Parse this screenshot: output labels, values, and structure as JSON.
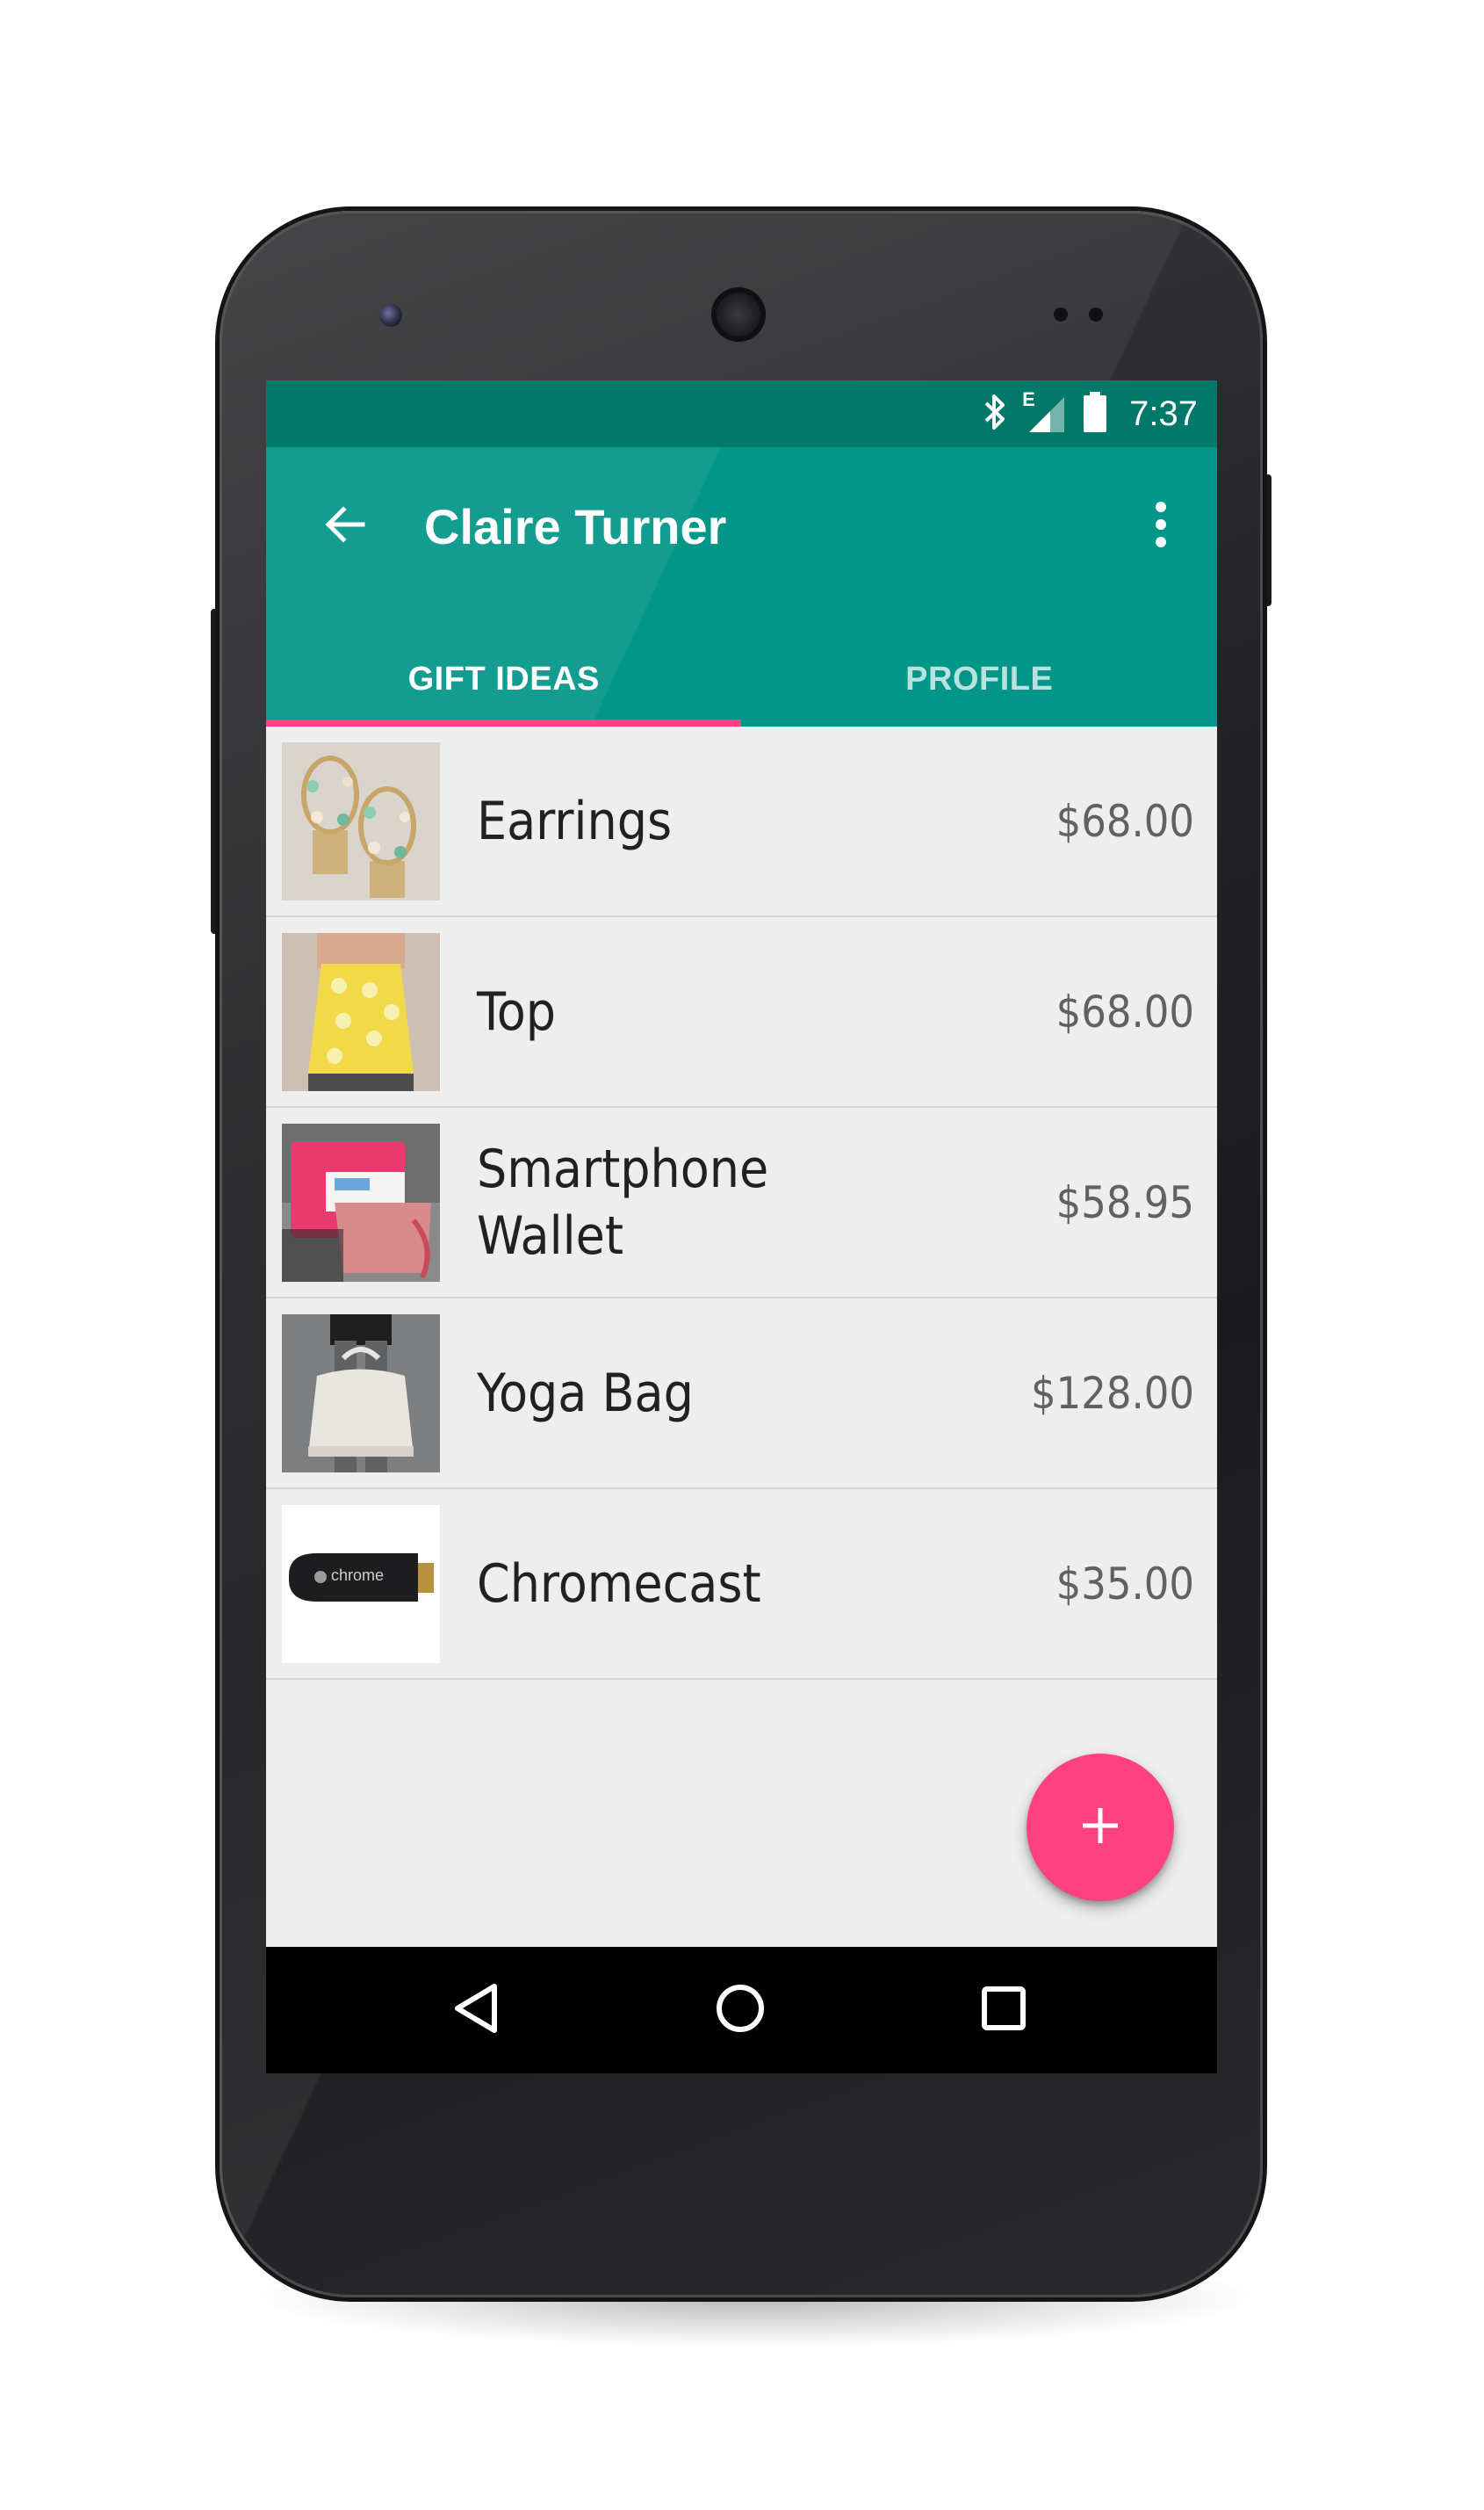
{
  "status_bar": {
    "time": "7:37",
    "network_type": "E",
    "icons": [
      "bluetooth-icon",
      "signal-icon",
      "battery-icon"
    ]
  },
  "app_bar": {
    "title": "Claire Turner",
    "back_icon": "arrow-back-icon",
    "menu_icon": "more-vert-icon"
  },
  "tabs": [
    {
      "label": "GIFT IDEAS",
      "selected": true
    },
    {
      "label": "PROFILE",
      "selected": false
    }
  ],
  "items": [
    {
      "name": "Earrings",
      "price": "$68.00",
      "image": "earrings-photo"
    },
    {
      "name": "Top",
      "price": "$68.00",
      "image": "top-photo"
    },
    {
      "name": "Smartphone Wallet",
      "price": "$58.95",
      "image": "wallet-photo"
    },
    {
      "name": "Yoga Bag",
      "price": "$128.00",
      "image": "yoga-bag-photo"
    },
    {
      "name": "Chromecast",
      "price": "$35.00",
      "image": "chromecast-photo"
    }
  ],
  "thumbnail_text": {
    "chromecast_logo": "chrome"
  },
  "fab": {
    "icon": "add-icon"
  },
  "nav_bar": {
    "icons": [
      "back-triangle-icon",
      "home-circle-icon",
      "recents-square-icon"
    ]
  },
  "colors": {
    "primary": "#009688",
    "primary_dark": "#00796b",
    "accent": "#ff4081",
    "background": "#eeeeee"
  }
}
